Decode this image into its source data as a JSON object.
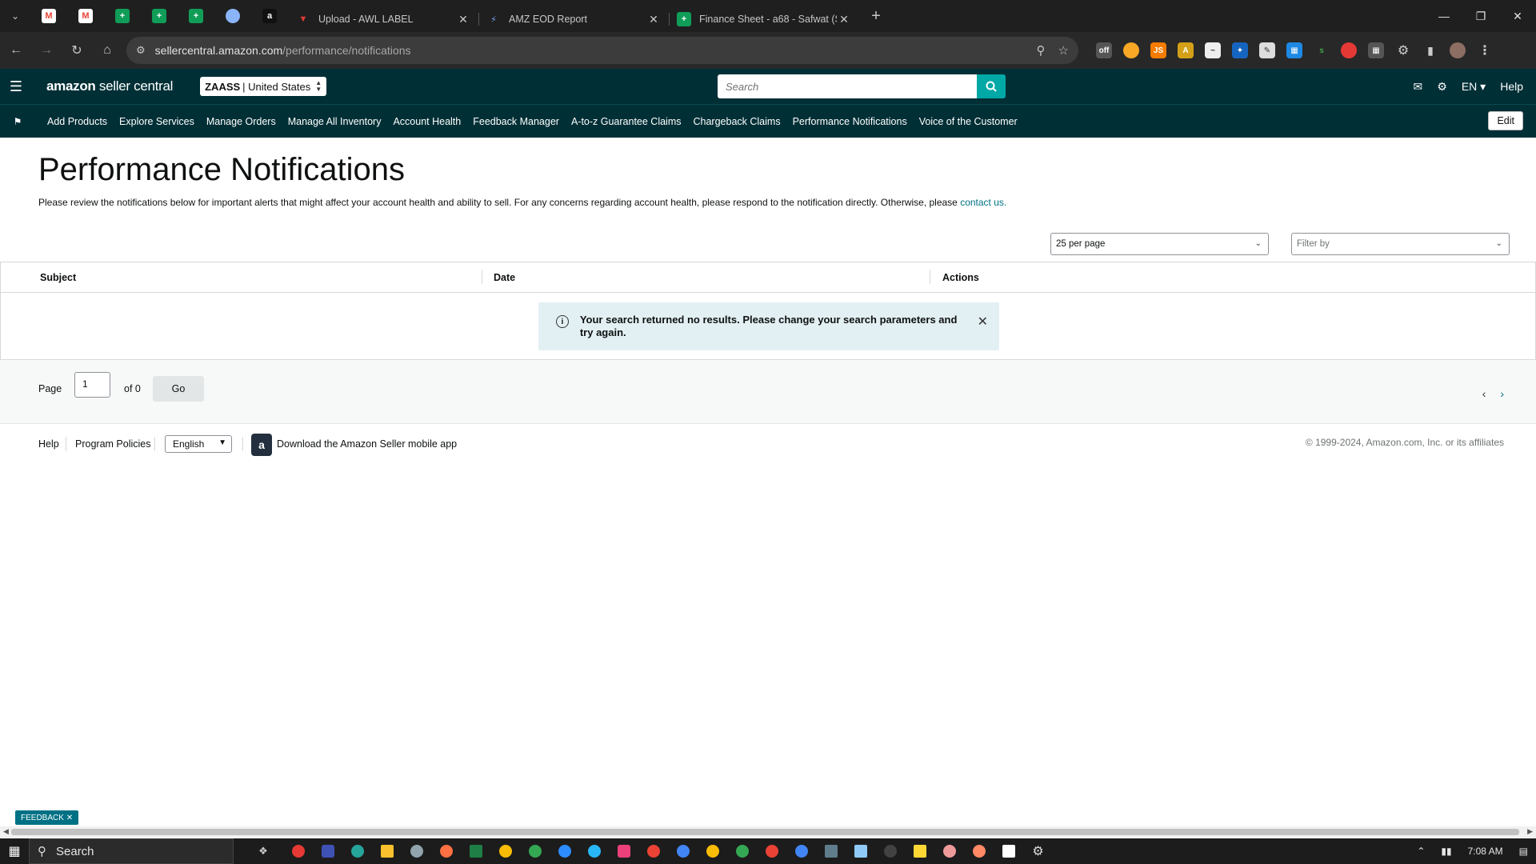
{
  "browser": {
    "tabs": [
      {
        "title": "Upload - AWL LABEL",
        "icon": "awl-label-icon"
      },
      {
        "title": "AMZ EOD Report",
        "icon": "eod-report-icon"
      },
      {
        "title": "Finance Sheet - a68 - Safwat (S",
        "icon": "google-sheets-icon"
      }
    ],
    "url_host": "sellercentral.amazon.com",
    "url_path": "/performance/notifications"
  },
  "header": {
    "logo_bold": "amazon",
    "logo_rest": " seller central",
    "store_name": "ZAASS",
    "store_region": "| United States",
    "search_placeholder": "Search",
    "language": "EN",
    "help": "Help"
  },
  "nav": {
    "links": [
      "Add Products",
      "Explore Services",
      "Manage Orders",
      "Manage All Inventory",
      "Account Health",
      "Feedback Manager",
      "A-to-z Guarantee Claims",
      "Chargeback Claims",
      "Performance Notifications",
      "Voice of the Customer"
    ],
    "edit": "Edit"
  },
  "page": {
    "title": "Performance Notifications",
    "intro": "Please review the notifications below for important alerts that might affect your account health and ability to sell. For any concerns regarding account health, please respond to the notification directly. Otherwise, please ",
    "contact_link": "contact us."
  },
  "filters": {
    "per_page": "25 per page",
    "filter_by": "Filter by"
  },
  "table": {
    "columns": [
      "Subject",
      "Date",
      "Actions"
    ],
    "empty_message": "Your search returned no results. Please change your search parameters and try again."
  },
  "pagination": {
    "page_label": "Page",
    "current_page": "1",
    "of_label": "of 0",
    "go": "Go"
  },
  "footer": {
    "help": "Help",
    "program_policies": "Program Policies",
    "language": "English",
    "app_text": "Download the Amazon Seller mobile app",
    "copyright": "© 1999-2024, Amazon.com, Inc. or its affiliates"
  },
  "feedback": "FEEDBACK",
  "taskbar": {
    "search": "Search",
    "time": "7:08 AM"
  }
}
